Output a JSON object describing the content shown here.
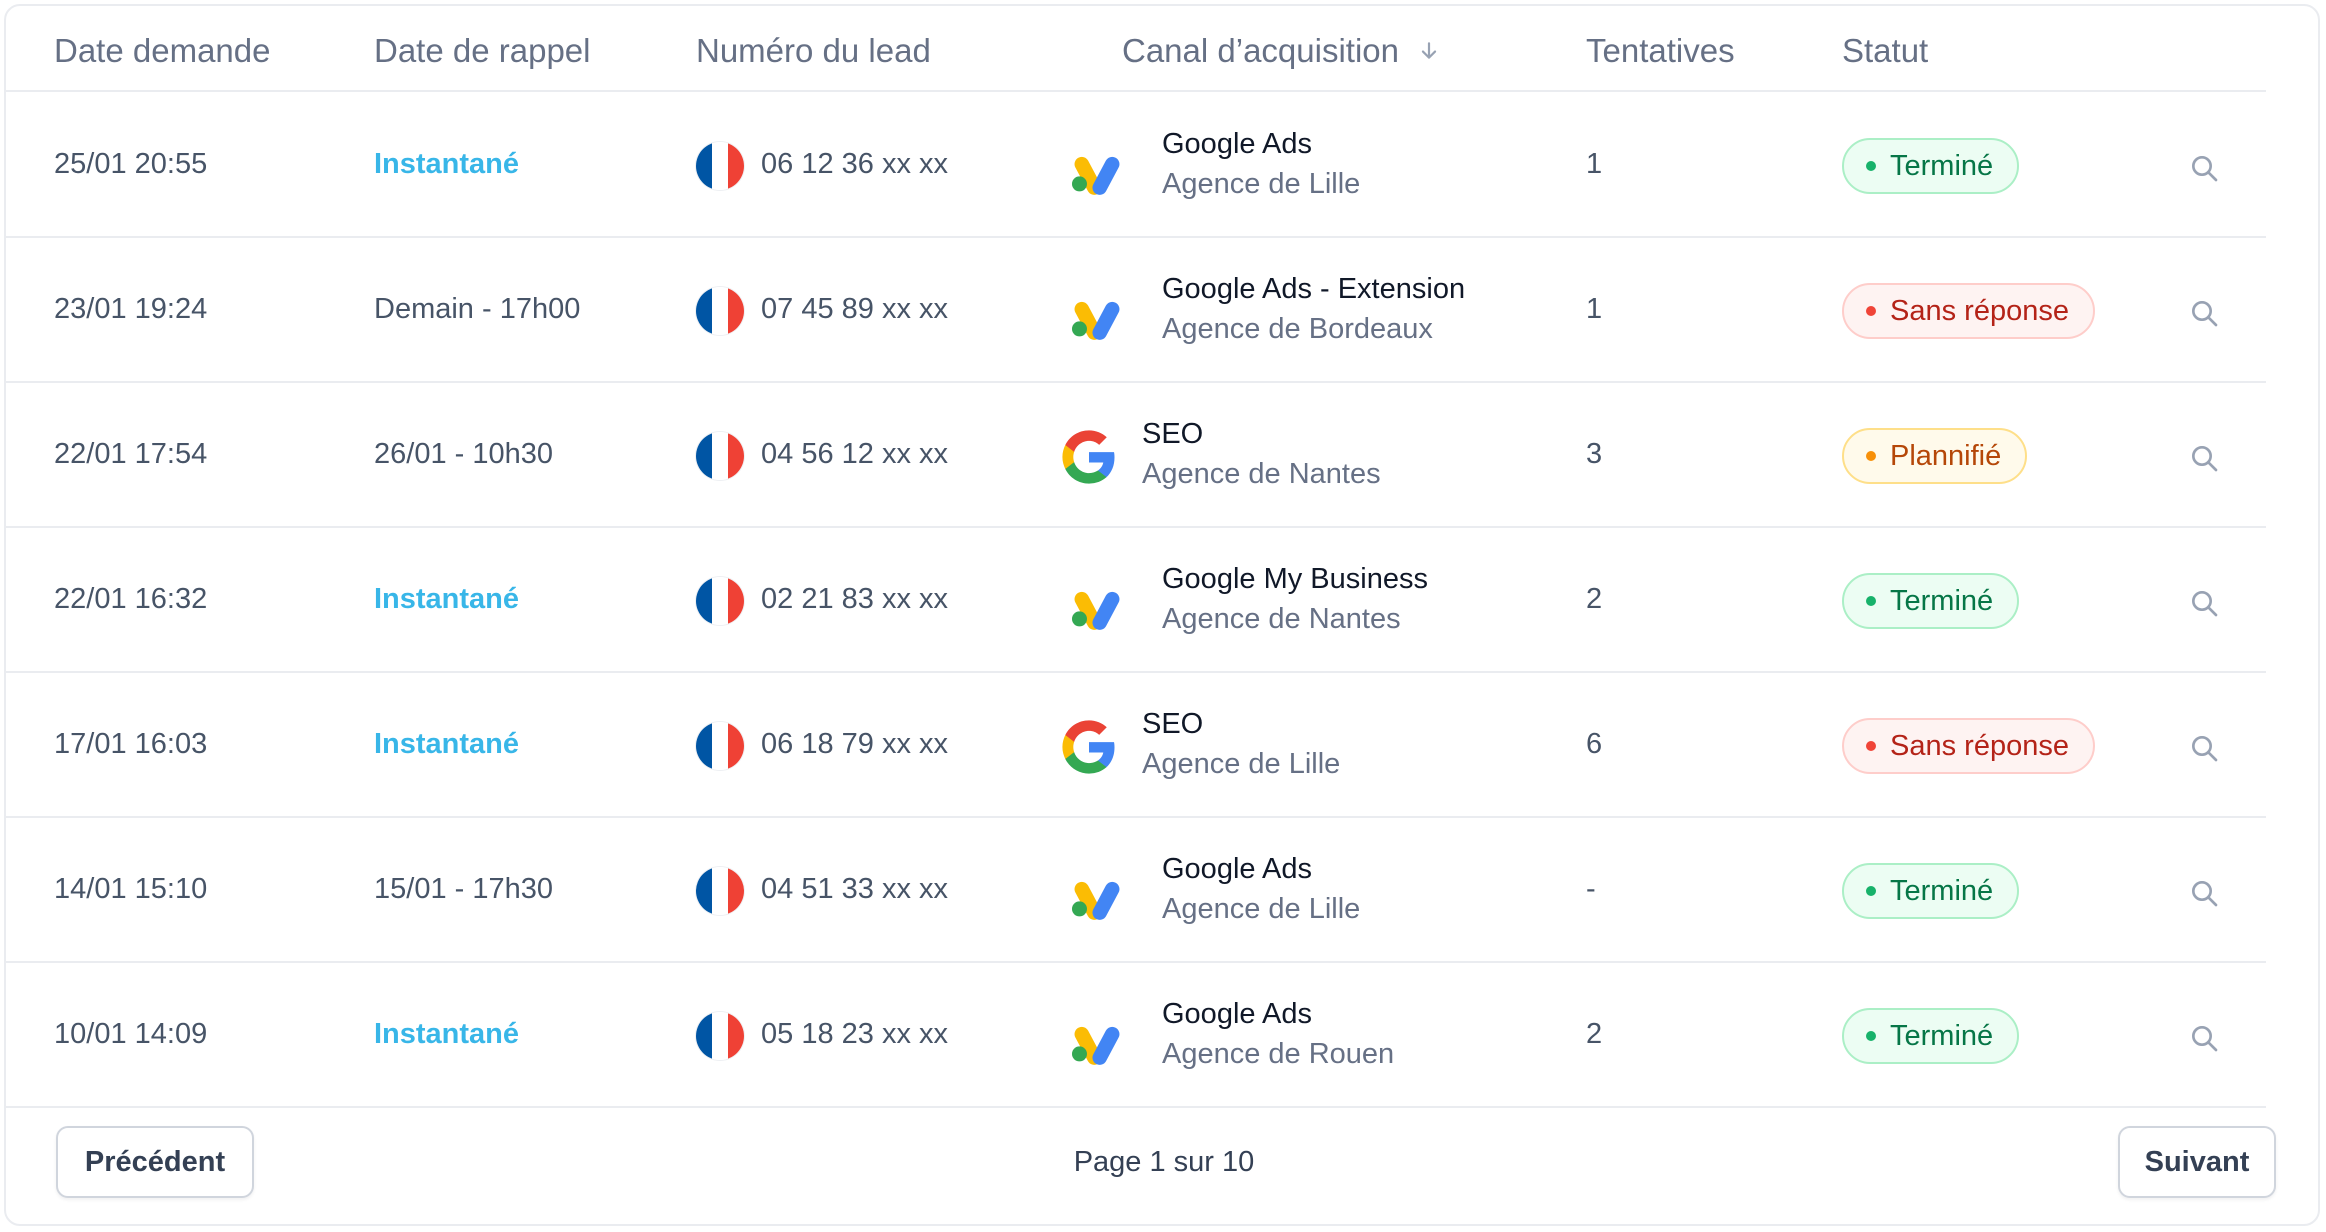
{
  "columns": {
    "date_demande": "Date demande",
    "date_rappel": "Date de rappel",
    "numero": "Numéro du lead",
    "canal": "Canal d’acquisition",
    "tentatives": "Tentatives",
    "statut": "Statut"
  },
  "rows": [
    {
      "date": "25/01 20:55",
      "rappel": "Instantané",
      "instant": true,
      "phone": "06 12 36 xx xx",
      "logo": "google-ads",
      "channel": "Google Ads",
      "agency": "Agence de Lille",
      "attempts": "1",
      "status": "Terminé",
      "status_type": "done"
    },
    {
      "date": "23/01 19:24",
      "rappel": "Demain - 17h00",
      "instant": false,
      "phone": "07 45 89 xx xx",
      "logo": "google-ads",
      "channel": "Google Ads - Extension",
      "agency": "Agence de Bordeaux",
      "attempts": "1",
      "status": "Sans réponse",
      "status_type": "noans"
    },
    {
      "date": "22/01 17:54",
      "rappel": "26/01 - 10h30",
      "instant": false,
      "phone": "04 56 12 xx xx",
      "logo": "google-g",
      "channel": "SEO",
      "agency": "Agence de Nantes",
      "attempts": "3",
      "status": "Plannifié",
      "status_type": "plan"
    },
    {
      "date": "22/01 16:32",
      "rappel": "Instantané",
      "instant": true,
      "phone": "02 21 83 xx xx",
      "logo": "google-ads",
      "channel": "Google My Business",
      "agency": "Agence de Nantes",
      "attempts": "2",
      "status": "Terminé",
      "status_type": "done"
    },
    {
      "date": "17/01 16:03",
      "rappel": "Instantané",
      "instant": true,
      "phone": "06 18 79 xx xx",
      "logo": "google-g",
      "channel": "SEO",
      "agency": "Agence de Lille",
      "attempts": "6",
      "status": "Sans réponse",
      "status_type": "noans"
    },
    {
      "date": "14/01 15:10",
      "rappel": "15/01 - 17h30",
      "instant": false,
      "phone": "04 51 33 xx xx",
      "logo": "google-ads",
      "channel": "Google Ads",
      "agency": "Agence de Lille",
      "attempts": "-",
      "status": "Terminé",
      "status_type": "done"
    },
    {
      "date": "10/01 14:09",
      "rappel": "Instantané",
      "instant": true,
      "phone": "05 18 23 xx xx",
      "logo": "google-ads",
      "channel": "Google Ads",
      "agency": "Agence de Rouen",
      "attempts": "2",
      "status": "Terminé",
      "status_type": "done"
    }
  ],
  "pagination": {
    "prev": "Précédent",
    "info": "Page 1 sur 10",
    "next": "Suivant"
  },
  "icons": {
    "flag": "france-flag-icon",
    "search": "magnifier-icon",
    "sort": "arrow-down-icon"
  },
  "colors": {
    "instant": "#38b6e8",
    "done": "#067647",
    "no_answer": "#b42318",
    "planned": "#b54708",
    "flag_blue": "#0055a4",
    "flag_red": "#ef4135"
  }
}
